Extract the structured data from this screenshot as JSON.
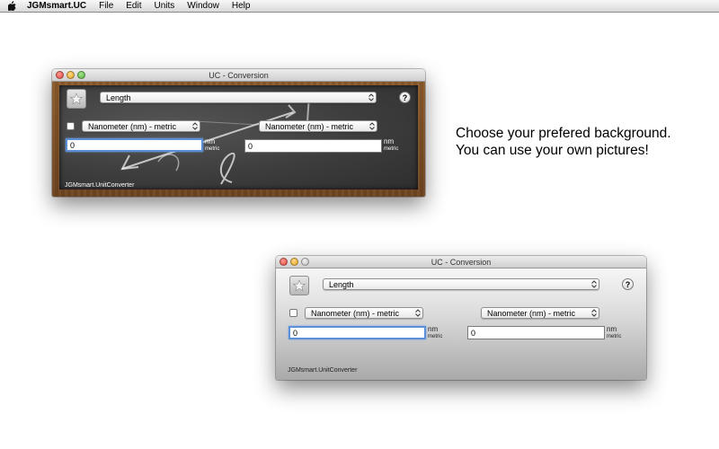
{
  "menubar": {
    "apple_icon": "apple-icon",
    "app_name": "JGMsmart.UC",
    "items": [
      {
        "label": "File"
      },
      {
        "label": "Edit"
      },
      {
        "label": "Units"
      },
      {
        "label": "Window"
      },
      {
        "label": "Help"
      }
    ]
  },
  "windows": [
    {
      "title": "UC - Conversion",
      "background": "chalkboard",
      "star_icon": "star-icon",
      "category": "Length",
      "help_label": "?",
      "from_unit": "Nanometer (nm) - metric",
      "to_unit": "Nanometer (nm) - metric",
      "from_value": "0",
      "to_value": "0",
      "from_abbr": "nm",
      "from_system": "metric",
      "to_abbr": "nm",
      "to_system": "metric",
      "footer": "JGMsmart.UnitConverter"
    },
    {
      "title": "UC - Conversion",
      "background": "gray-gradient",
      "star_icon": "star-icon",
      "category": "Length",
      "help_label": "?",
      "from_unit": "Nanometer (nm) - metric",
      "to_unit": "Nanometer (nm) - metric",
      "from_value": "0",
      "to_value": "0",
      "from_abbr": "nm",
      "from_system": "metric",
      "to_abbr": "nm",
      "to_system": "metric",
      "footer": "JGMsmart.UnitConverter"
    }
  ],
  "promo": {
    "line1": "Choose your prefered background.",
    "line2": "You can use your own pictures!"
  },
  "colors": {
    "focus_ring": "#5b8fd6",
    "chalkboard": "#3d3d3d",
    "frame_wood": "#7a4c24"
  }
}
